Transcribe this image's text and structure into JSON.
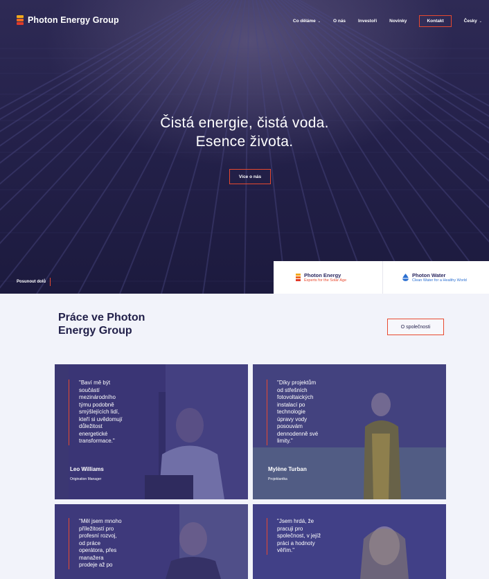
{
  "header": {
    "brand": "Photon Energy Group",
    "nav": [
      {
        "label": "Co děláme",
        "dropdown": true
      },
      {
        "label": "O nás",
        "dropdown": false
      },
      {
        "label": "Investoři",
        "dropdown": false
      },
      {
        "label": "Novinky",
        "dropdown": false
      },
      {
        "label": "Kontakt",
        "dropdown": false
      },
      {
        "label": "Česky",
        "dropdown": true
      }
    ]
  },
  "hero": {
    "title_line1": "Čistá energie, čistá voda.",
    "title_line2": "Esence života.",
    "cta": "Více o nás",
    "scroll": "Posunout dolů"
  },
  "brands": [
    {
      "name": "Photon Energy",
      "tagline": "Experts for the Solar Age"
    },
    {
      "name": "Photon Water",
      "tagline": "Clean Water for a Healthy World"
    }
  ],
  "careers": {
    "title_line1": "Práce ve Photon",
    "title_line2": "Energy Group",
    "button": "O společnosti",
    "cards": [
      {
        "quote": [
          "\"Baví mě být",
          "součástí",
          "mezinárodního",
          "týmu podobně",
          "smýšlejících lidí,",
          "kteří si uvědomují",
          "důležitost",
          "energetické",
          "transformace.\""
        ],
        "name": "Leo Williams",
        "role": "Origination Manager"
      },
      {
        "quote": [
          "\"Díky projektům",
          "od střešních",
          "fotovoltaických",
          "instalací po",
          "technologie",
          "úpravy vody",
          "posouvám",
          "dennodenně své",
          "limity.\""
        ],
        "name": "Mylène Turban",
        "role": "Projektantka"
      },
      {
        "quote": [
          "\"Měl jsem mnoho",
          "příležitostí pro",
          "profesní rozvoj,",
          "od práce",
          "operátora, přes",
          "manažera",
          "prodeje až po"
        ],
        "name": "",
        "role": ""
      },
      {
        "quote": [
          "\"Jsem hrdá, že",
          "pracuji pro",
          "společnost, v jejíž",
          "práci a hodnoty",
          "věřím.\""
        ],
        "name": "",
        "role": ""
      }
    ]
  },
  "colors": {
    "accent": "#e8492f",
    "navy": "#22204a",
    "hero_bg": "#24214a",
    "brand_blue": "#2b6fd1"
  }
}
